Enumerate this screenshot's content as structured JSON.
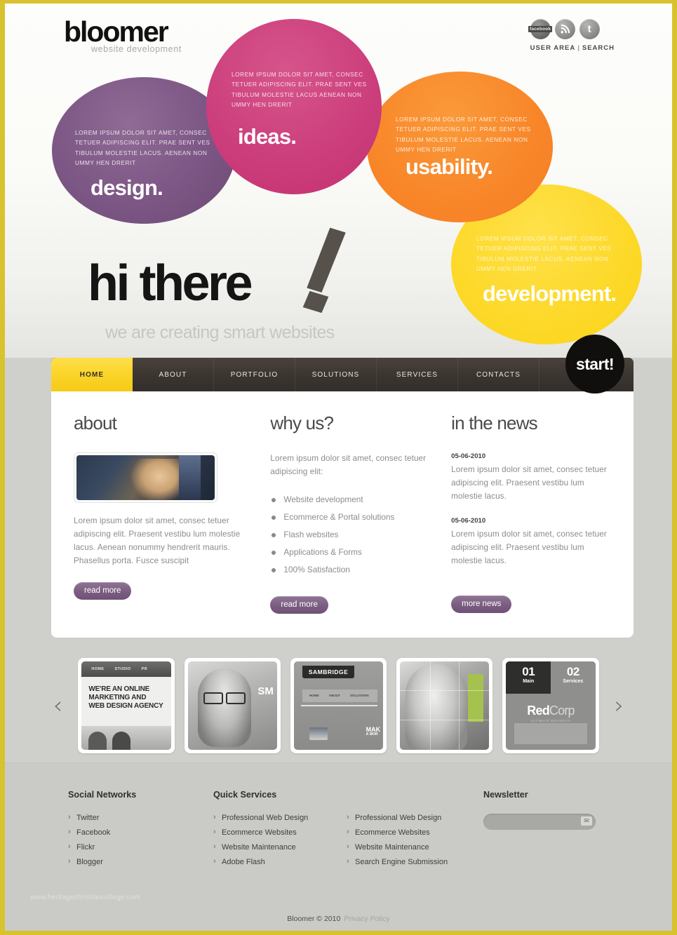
{
  "brand": {
    "name": "bloomer",
    "tagline": "website development"
  },
  "topbar": {
    "icons": [
      {
        "name": "facebook-icon",
        "glyph": "facebook"
      },
      {
        "name": "rss-icon",
        "glyph": "(·"
      },
      {
        "name": "twitter-icon",
        "glyph": "t"
      }
    ],
    "user_area": "USER AREA",
    "separator": "|",
    "search": "SEARCH"
  },
  "hero": {
    "circles": [
      {
        "word": "design.",
        "color": "#7c5684",
        "lorem": "LOREM IPSUM DOLOR SIT AMET, CONSEC TETUER ADIPISCING ELIT. PRAE SENT VES TIBULUM MOLESTIE LACUS. AENEAN NON UMMY HEN DRERIT"
      },
      {
        "word": "ideas.",
        "color": "#cc3f7c",
        "lorem": "LOREM IPSUM DOLOR SIT AMET, CONSEC TETUER ADIPISCING ELIT. PRAE SENT VES TIBULUM MOLESTIE LACUS AENEAN NON UMMY HEN DRERIT"
      },
      {
        "word": "usability.",
        "color": "#f8872a",
        "lorem": "LOREM IPSUM DOLOR SIT AMET, CONSEC TETUER ADIPISCING ELIT. PRAE SENT VES TIBULUM MOLESTIE LACUS. AENEAN NON UMMY HEN DRERIT"
      },
      {
        "word": "development.",
        "color": "#fbd417",
        "lorem": "LOREM IPSUM DOLOR SIT AMET, CONSEC TETUER ADIPISCING ELIT. PRAE SENT VES TIBULUM MOLESTIE LACUS. AENEAN NON UMMY HEN DRERIT"
      }
    ],
    "headline": "hi there",
    "subheadline": "we are creating smart websites"
  },
  "nav": {
    "items": [
      {
        "label": "HOME",
        "active": true
      },
      {
        "label": "ABOUT",
        "active": false
      },
      {
        "label": "PORTFOLIO",
        "active": false
      },
      {
        "label": "SOLUTIONS",
        "active": false
      },
      {
        "label": "SERVICES",
        "active": false
      },
      {
        "label": "CONTACTS",
        "active": false
      }
    ],
    "start_label": "start!"
  },
  "about": {
    "heading": "about",
    "text": "Lorem ipsum dolor sit amet, consec tetuer adipiscing elit. Praesent vestibu lum molestie lacus. Aenean nonummy hendrerit mauris. Phasellus porta. Fusce suscipit",
    "button": "read more"
  },
  "whyus": {
    "heading": "why us?",
    "intro": "Lorem ipsum dolor sit amet, consec tetuer adipiscing elit:",
    "items": [
      "Website development",
      "Ecommerce & Portal solutions",
      "Flash websites",
      "Applications & Forms",
      "100% Satisfaction"
    ],
    "button": "read more"
  },
  "news": {
    "heading": "in the news",
    "items": [
      {
        "date": "05-06-2010",
        "text": "Lorem ipsum dolor sit amet, consec tetuer adipiscing elit. Praesent vestibu lum molestie lacus."
      },
      {
        "date": "05-06-2010",
        "text": "Lorem ipsum dolor sit amet, consec tetuer adipiscing elit. Praesent vestibu lum molestie lacus."
      }
    ],
    "button": "more news"
  },
  "carousel": {
    "prev": "‹",
    "next": "›",
    "slides": [
      {
        "nav": [
          "HOME",
          "STUDIO",
          "PR"
        ],
        "headline": "WE'RE AN ONLINE MARKETING AND WEB DESIGN AGENCY"
      },
      {
        "watermark": "SM"
      },
      {
        "title": "SAMBRIDGE",
        "nav": [
          "HOME",
          "ABOUT",
          "SOLUTIONS"
        ],
        "headline": "MAK",
        "subheadline": "A WOR"
      },
      {},
      {
        "tabs": [
          {
            "num": "01",
            "label": "Main"
          },
          {
            "num": "02",
            "label": "Services"
          }
        ],
        "logo_bold": "Red",
        "logo_light": "Corp",
        "logo_sub": "ULTIMATE BUSINESS"
      }
    ]
  },
  "footer": {
    "social": {
      "heading": "Social Networks",
      "items": [
        "Twitter",
        "Facebook",
        "Flickr",
        "Blogger"
      ]
    },
    "quick": {
      "heading": "Quick Services",
      "col_a": [
        "Professional Web Design",
        "Ecommerce Websites",
        "Website Maintenance",
        "Adobe Flash"
      ],
      "col_b": [
        "Professional Web Design",
        "Ecommerce Websites",
        "Website Maintenance",
        "Search Engine Submission"
      ]
    },
    "newsletter": {
      "heading": "Newsletter",
      "value": "",
      "placeholder": "",
      "submit_icon": "✉"
    },
    "watermark": "www.heritagechristiancollege.com",
    "copyright": "Bloomer © 2010",
    "privacy": "Privacy Policy"
  }
}
